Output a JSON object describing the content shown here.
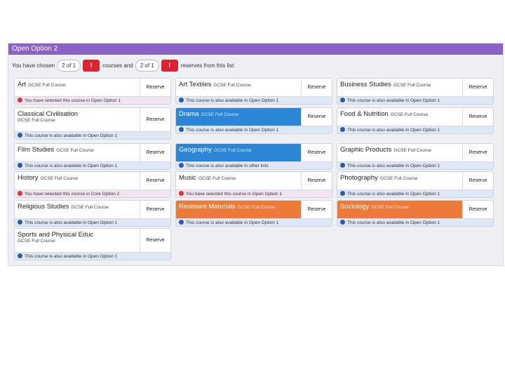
{
  "panel": {
    "title": "Open Option 2",
    "summary": {
      "prefix": "You have chosen",
      "courses_count": "2 of 1",
      "middle": "courses and",
      "reserves_count": "2 of 1",
      "suffix": "reserves from this list",
      "alert_label": "!"
    }
  },
  "colors": {
    "header": "#8a62c4",
    "alert": "#dd2233",
    "choice_blue": "#2b86d8",
    "choice_orange": "#ee7a3a"
  },
  "columns": [
    [
      {
        "name": "Art",
        "type": "GCSE Full Course",
        "reserve": "Reserve",
        "note": "You have selected this course in Open Option 1",
        "note_kind": "selected",
        "style": "plain",
        "two_line": false
      },
      {
        "name": "Classical Civilisation",
        "type": "GCSE Full Course",
        "reserve": "Reserve",
        "note": "This course is also available in Open Option 1",
        "note_kind": "info",
        "style": "plain",
        "two_line": true
      },
      {
        "name": "Film Studies",
        "type": "GCSE Full Course",
        "reserve": "Reserve",
        "note": "This course is also available in Open Option 1",
        "note_kind": "info",
        "style": "plain",
        "two_line": false
      },
      {
        "name": "History",
        "type": "GCSE Full Course",
        "reserve": "Reserve",
        "note": "You have selected this course in Core Option 2",
        "note_kind": "selected",
        "style": "plain",
        "two_line": false
      },
      {
        "name": "Religious Studies",
        "type": "GCSE Full Course",
        "reserve": "Reserve",
        "note": "This course is also available in Open Option 1",
        "note_kind": "info",
        "style": "plain",
        "two_line": false
      },
      {
        "name": "Sports and Physical Educ",
        "type": "GCSE Full Course",
        "reserve": "Reserve",
        "note": "This course is also available in Open Option 1",
        "note_kind": "info",
        "style": "plain",
        "two_line": true
      }
    ],
    [
      {
        "name": "Art Textiles",
        "type": "GCSE Full Course",
        "reserve": "Reserve",
        "note": "This course is also available in Open Option 1",
        "note_kind": "info",
        "style": "plain",
        "two_line": false
      },
      {
        "name": "Drama",
        "type": "GCSE Full Course",
        "reserve": "Reserve",
        "note": "This course is also available in Open Option 1",
        "note_kind": "info",
        "style": "blue",
        "two_line": false
      },
      {
        "name": "Geography",
        "type": "GCSE Full Course",
        "reserve": "Reserve",
        "note": "This course is also available in other lists",
        "note_kind": "info",
        "style": "blue",
        "two_line": false
      },
      {
        "name": "Music",
        "type": "GCSE Full Course",
        "reserve": "Reserve",
        "note": "You have selected this course in Open Option 1",
        "note_kind": "selected",
        "style": "plain",
        "two_line": false
      },
      {
        "name": "Resistant Materials",
        "type": "GCSE Full Course",
        "reserve": "Reserve",
        "note": "This course is also available in Open Option 1",
        "note_kind": "info",
        "style": "orange",
        "two_line": false
      }
    ],
    [
      {
        "name": "Business Studies",
        "type": "GCSE Full Course",
        "reserve": "Reserve",
        "note": "This course is also available in Open Option 1",
        "note_kind": "info",
        "style": "plain",
        "two_line": false
      },
      {
        "name": "Food & Nutrition",
        "type": "GCSE Full Course",
        "reserve": "Reserve",
        "note": "This course is also available in Open Option 1",
        "note_kind": "info",
        "style": "plain",
        "two_line": false
      },
      {
        "name": "Graphic Products",
        "type": "GCSE Full Course",
        "reserve": "Reserve",
        "note": "This course is also available in Open Option 1",
        "note_kind": "info",
        "style": "plain",
        "two_line": false
      },
      {
        "name": "Photography",
        "type": "GCSE Full Course",
        "reserve": "Reserve",
        "note": "This course is also available in Open Option 1",
        "note_kind": "info",
        "style": "plain",
        "two_line": false
      },
      {
        "name": "Sociology",
        "type": "GCSE Full Course",
        "reserve": "Reserve",
        "note": "This course is also available in Open Option 1",
        "note_kind": "info",
        "style": "orange",
        "two_line": false
      }
    ]
  ]
}
